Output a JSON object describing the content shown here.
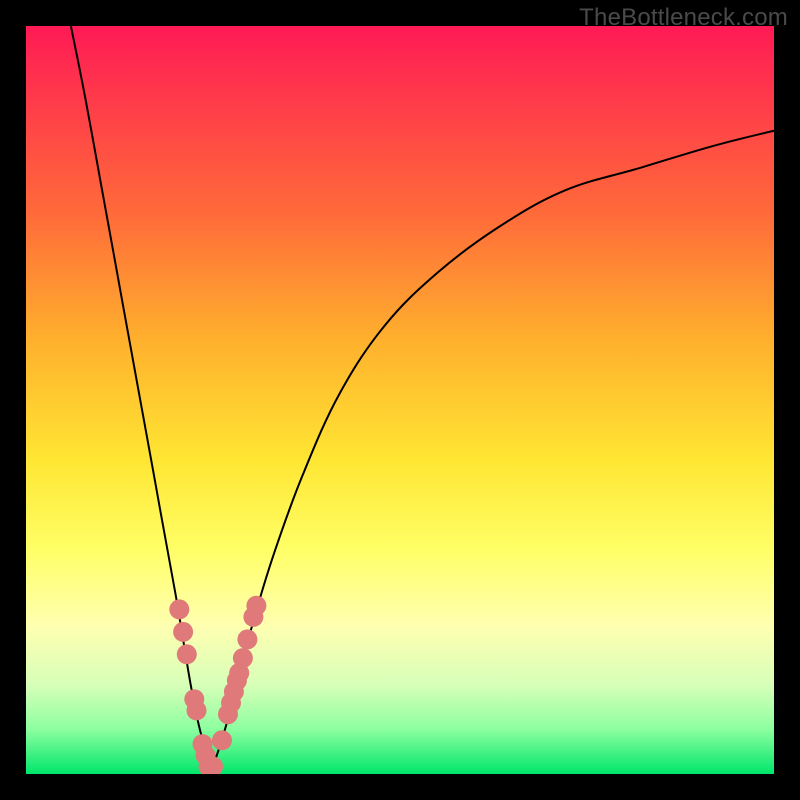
{
  "watermark": "TheBottleneck.com",
  "colors": {
    "background_frame": "#000000",
    "gradient_top": "#ff1a55",
    "gradient_bottom": "#00e66a",
    "curve": "#000000",
    "marker": "#e07a7a"
  },
  "chart_data": {
    "type": "line",
    "title": "",
    "xlabel": "",
    "ylabel": "",
    "xlim": [
      0,
      100
    ],
    "ylim": [
      0,
      100
    ],
    "grid": false,
    "note": "No axis ticks or numeric labels shown. Values are estimated from pixel positions on a 0–100 normalized scale (x left→right, y bottom→top).",
    "series": [
      {
        "name": "left-branch",
        "x": [
          6,
          8,
          10,
          12,
          14,
          16,
          18,
          20,
          21,
          22,
          23,
          24,
          24.6
        ],
        "y": [
          100,
          90,
          79,
          68,
          57,
          46,
          35,
          24,
          18,
          12,
          7,
          3,
          0
        ]
      },
      {
        "name": "right-branch",
        "x": [
          24.6,
          26,
          28,
          30,
          33,
          37,
          42,
          48,
          55,
          63,
          72,
          82,
          92,
          100
        ],
        "y": [
          0,
          4,
          11,
          19,
          29,
          40,
          51,
          60,
          67,
          73,
          78,
          81,
          84,
          86
        ]
      }
    ],
    "markers": {
      "name": "highlighted-points",
      "x": [
        20.5,
        21,
        21.5,
        22.5,
        22.8,
        23.6,
        24,
        24.4,
        25,
        26.2,
        27,
        27.4,
        27.8,
        28.2,
        28.5,
        29,
        29.6,
        30.4,
        30.8
      ],
      "y": [
        22,
        19,
        16,
        10,
        8.5,
        4,
        2.5,
        1,
        1,
        4.5,
        8,
        9.5,
        11,
        12.5,
        13.5,
        15.5,
        18,
        21,
        22.5
      ],
      "size": 10
    }
  }
}
